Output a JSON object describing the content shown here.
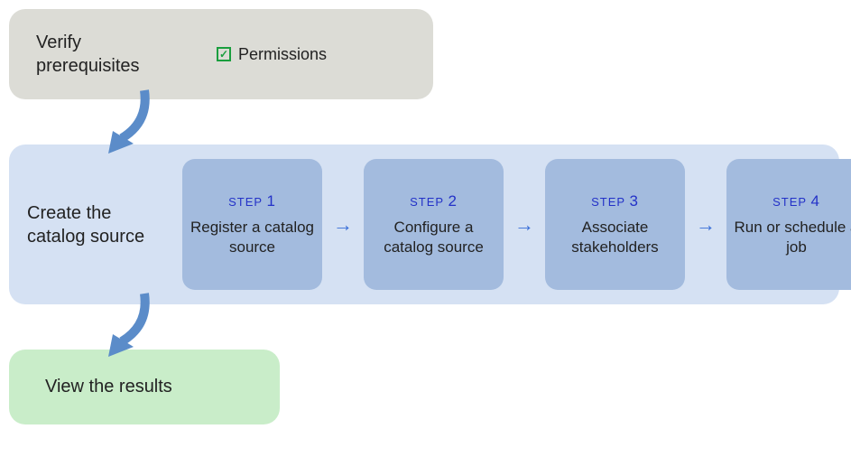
{
  "stage1": {
    "title": "Verify prerequisites",
    "permissions_label": "Permissions"
  },
  "stage2": {
    "title": "Create the catalog source",
    "steps": [
      {
        "num_label": "STEP",
        "num": "1",
        "desc": "Register a catalog source"
      },
      {
        "num_label": "STEP",
        "num": "2",
        "desc": "Configure a catalog source"
      },
      {
        "num_label": "STEP",
        "num": "3",
        "desc": "Associate stakeholders"
      },
      {
        "num_label": "STEP",
        "num": "4",
        "desc": "Run or schedule a job"
      }
    ]
  },
  "stage3": {
    "title": "View the results"
  }
}
